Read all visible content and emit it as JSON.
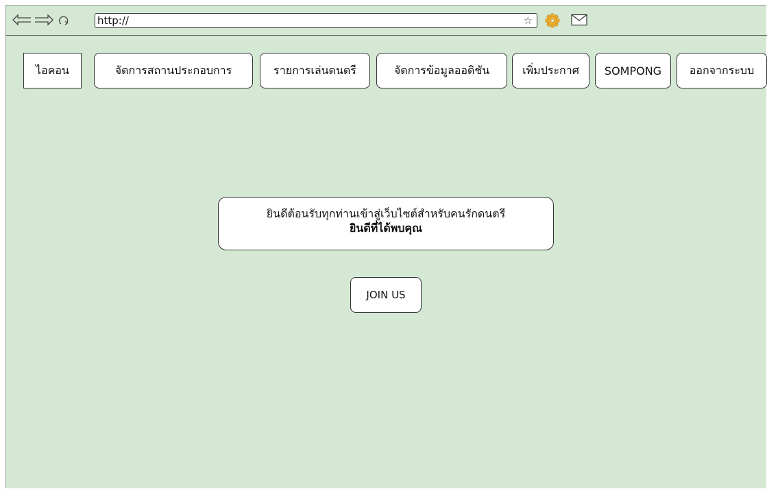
{
  "browser": {
    "url": "http://",
    "bookmark_icon": "☆",
    "icons": {
      "back": "back-arrow-icon",
      "forward": "forward-arrow-icon",
      "reload": "reload-icon",
      "settings": "gear-icon",
      "mail": "mail-icon"
    }
  },
  "menu": {
    "items": [
      {
        "label": "ไอคอน"
      },
      {
        "label": "จัดการสถานประกอบการ"
      },
      {
        "label": "รายการเล่นดนตรี"
      },
      {
        "label": "จัดการข้อมูลออดิชัน"
      },
      {
        "label": "เพิ่มประกาศ"
      },
      {
        "label": "SOMPONG"
      },
      {
        "label": "ออกจากระบบ"
      }
    ]
  },
  "main": {
    "welcome_line1": "ยินดีต้อนรับทุกท่านเข้าสู่เว็บไซต์สำหรับคนรักดนตรี",
    "welcome_line2": "ยินดีที่ได้พบคุณ",
    "join_label": "JOIN US"
  },
  "colors": {
    "page_background": "#d5e8d4",
    "button_background": "#ffffff",
    "border": "#333333",
    "gear": "#f0b030"
  }
}
